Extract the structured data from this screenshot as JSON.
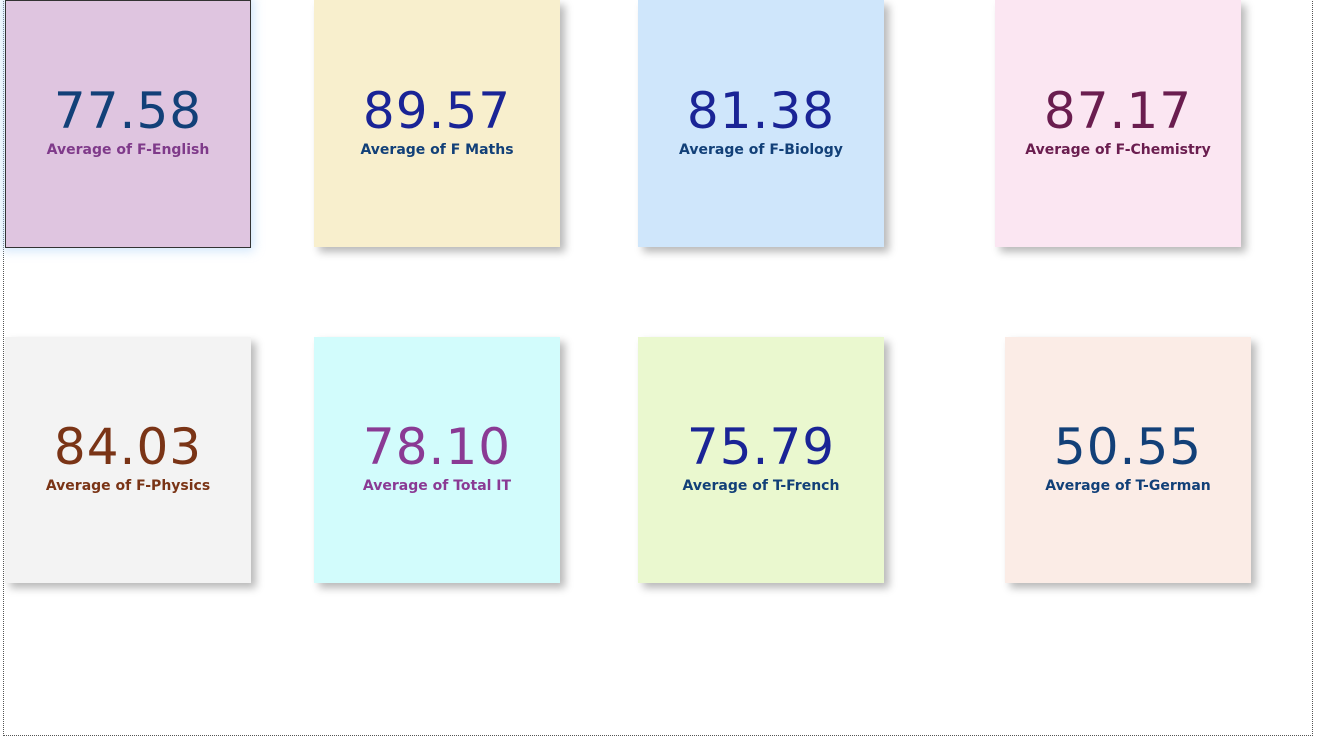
{
  "cards": [
    {
      "value": "77.58",
      "label": "Average of F-English",
      "bg": "#dfc5e0",
      "value_color": "#124078",
      "label_color": "#7f3a8a"
    },
    {
      "value": "89.57",
      "label": "Average of F Maths",
      "bg": "#f8efcd",
      "value_color": "#1a2496",
      "label_color": "#124078"
    },
    {
      "value": "81.38",
      "label": "Average of F-Biology",
      "bg": "#cfe6fb",
      "value_color": "#1a2496",
      "label_color": "#124078"
    },
    {
      "value": "87.17",
      "label": "Average of F-Chemistry",
      "bg": "#fbe6f2",
      "value_color": "#6a1d4f",
      "label_color": "#6a1d4f"
    },
    {
      "value": "84.03",
      "label": "Average of F-Physics",
      "bg": "#f3f3f3",
      "value_color": "#7a3416",
      "label_color": "#7a3416"
    },
    {
      "value": "78.10",
      "label": "Average of Total IT",
      "bg": "#d2fcfc",
      "value_color": "#8a3a94",
      "label_color": "#8a3a94"
    },
    {
      "value": "75.79",
      "label": "Average of T-French",
      "bg": "#eaf8cf",
      "value_color": "#1a2496",
      "label_color": "#124078"
    },
    {
      "value": "50.55",
      "label": "Average of T-German",
      "bg": "#fbece6",
      "value_color": "#124078",
      "label_color": "#124078"
    }
  ]
}
